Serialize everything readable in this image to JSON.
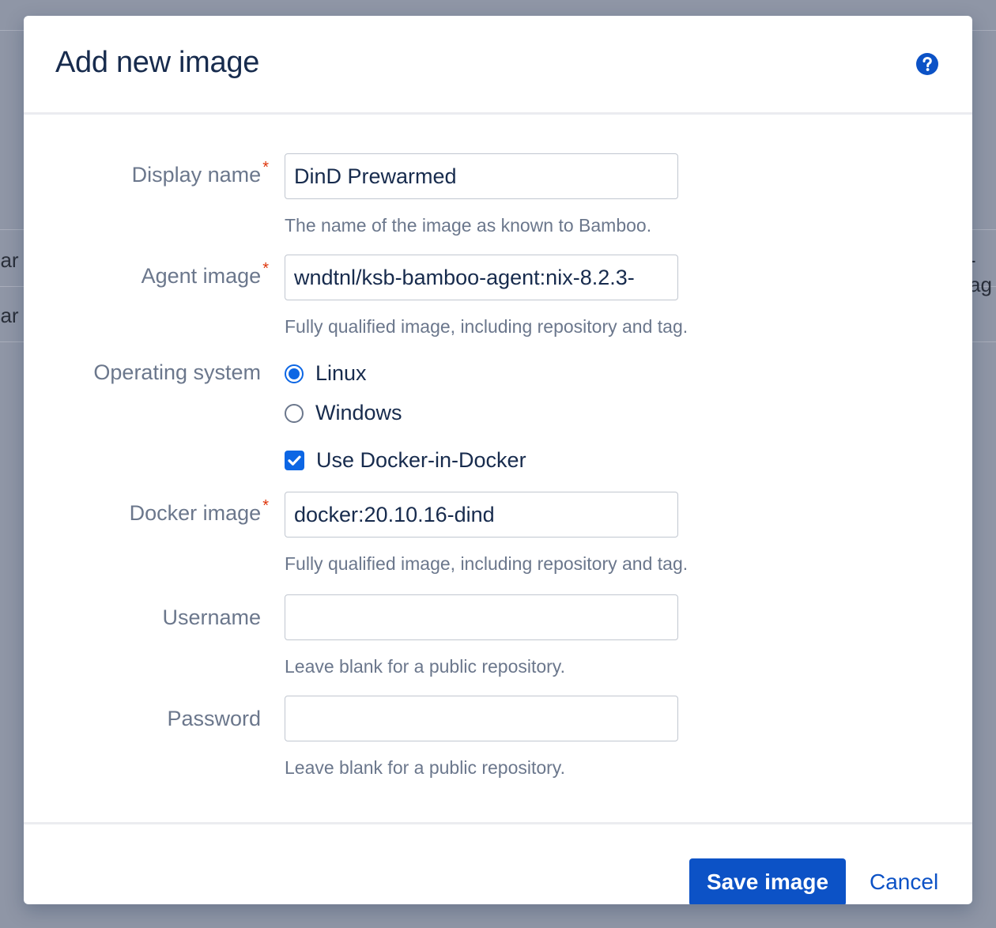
{
  "background": {
    "left_fragments": [
      "oar",
      "oar"
    ],
    "right_fragments": [
      "-ag"
    ]
  },
  "dialog": {
    "title": "Add new image",
    "help_icon": "question-circle-icon"
  },
  "form": {
    "display_name": {
      "label": "Display name",
      "required_marker": "*",
      "value": "DinD Prewarmed",
      "description": "The name of the image as known to Bamboo."
    },
    "agent_image": {
      "label": "Agent image",
      "required_marker": "*",
      "value": "wndtnl/ksb-bamboo-agent:nix-8.2.3-",
      "description": "Fully qualified image, including repository and tag."
    },
    "operating_system": {
      "label": "Operating system",
      "options": [
        {
          "label": "Linux",
          "selected": true
        },
        {
          "label": "Windows",
          "selected": false
        }
      ]
    },
    "docker_in_docker": {
      "label": "Use Docker-in-Docker",
      "checked": true
    },
    "docker_image": {
      "label": "Docker image",
      "required_marker": "*",
      "value": "docker:20.10.16-dind",
      "description": "Fully qualified image, including repository and tag."
    },
    "username": {
      "label": "Username",
      "value": "",
      "description": "Leave blank for a public repository."
    },
    "password": {
      "label": "Password",
      "value": "",
      "description": "Leave blank for a public repository."
    }
  },
  "footer": {
    "save_label": "Save image",
    "cancel_label": "Cancel"
  },
  "colors": {
    "primary": "#0c52c6",
    "checkbox_accent": "#0c66e4",
    "required": "#de350b",
    "overlay": "#8f96a6"
  }
}
